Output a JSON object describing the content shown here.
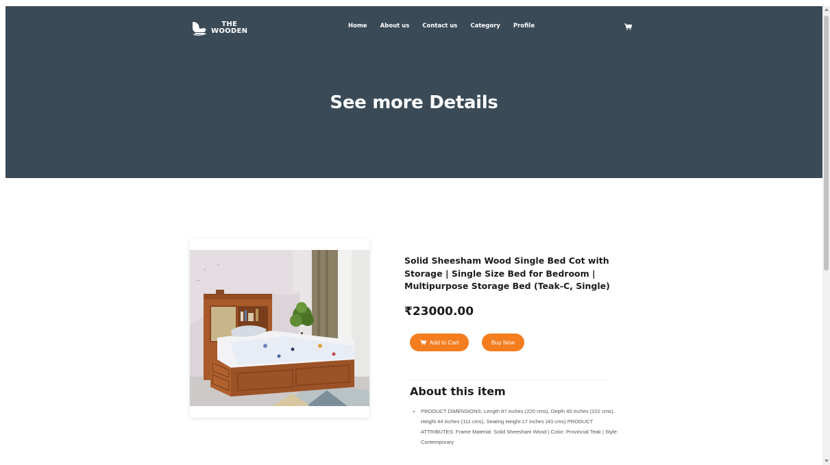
{
  "brand": {
    "line1": "THE",
    "line2": "WOODEN"
  },
  "nav": {
    "items": [
      {
        "label": "Home"
      },
      {
        "label": "About us"
      },
      {
        "label": "Contact us"
      },
      {
        "label": "Category"
      },
      {
        "label": "Profile"
      }
    ]
  },
  "hero": {
    "title": "See more Details"
  },
  "product": {
    "title": "Solid Sheesham Wood Single Bed Cot with Storage | Single Size Bed for Bedroom | Multipurpose Storage Bed (Teak-C, Single)",
    "price": "₹23000.00",
    "add_to_cart_label": "Add to Cart",
    "buy_now_label": "Buy Now",
    "image_icon": "product-photo"
  },
  "about": {
    "title": "About this item",
    "items": [
      "PRODUCT DIMENSIONS: Length 87 inches (220 cms), Depth 40 inches (101 cms), Height 44 inches (111 cms), Seating Height 17 inches (43 cms) PRODUCT ATTRIBUTES: Frame Material: Solid Sheesham Wood | Color: Provincial Teak | Style: Contemporary"
    ]
  },
  "colors": {
    "hero_bg": "#3a4a56",
    "accent": "#f47d1f",
    "text_dark": "#1b1b1b"
  },
  "icons": {
    "cart": "cart-icon",
    "logo": "chair-logo-icon"
  }
}
